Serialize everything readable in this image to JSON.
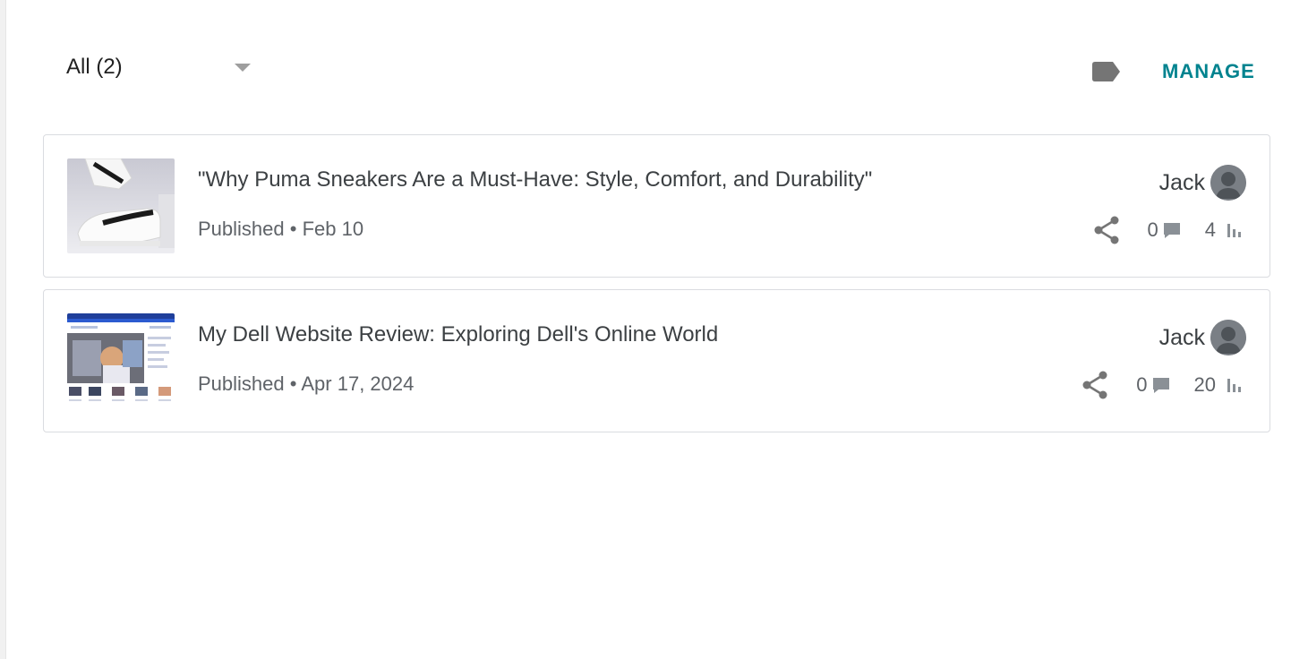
{
  "filter": {
    "selected": "All (2)"
  },
  "toolbar": {
    "manage_label": "MANAGE"
  },
  "posts": [
    {
      "title": "\"Why Puma Sneakers Are a Must-Have: Style, Comfort, and Durability\"",
      "status": "Published",
      "separator": "•",
      "date": "Feb 10",
      "author": "Jack",
      "comments": "0",
      "views": "4"
    },
    {
      "title": "My Dell Website Review: Exploring Dell's Online World",
      "status": "Published",
      "separator": "•",
      "date": "Apr 17, 2024",
      "author": "Jack",
      "comments": "0",
      "views": "20"
    }
  ],
  "colors": {
    "accent": "#00838f",
    "icon_gray": "#757575",
    "text": "#3c4043"
  }
}
